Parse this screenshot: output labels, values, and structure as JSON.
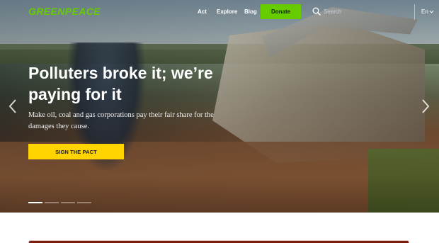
{
  "header": {
    "logo": "GREENPEACE",
    "nav": [
      {
        "label": "Act"
      },
      {
        "label": "Explore"
      },
      {
        "label": "Blog"
      }
    ],
    "donate_label": "Donate",
    "search": {
      "placeholder": "Search"
    },
    "language": "En"
  },
  "hero": {
    "headline": "Polluters broke it; we’re paying for it",
    "subtext": "Make oil, coal and gas corporations pay their fair share for the damages they cause.",
    "cta_label": "SIGN THE PACT",
    "slides": {
      "count": 4,
      "active": 1
    }
  },
  "colors": {
    "brand_green": "#66cc00",
    "cta_yellow": "#ffd400",
    "card_red": "#7a1e12"
  },
  "icons": [
    "search-icon",
    "chevron-down-icon",
    "chevron-left-icon",
    "chevron-right-icon"
  ]
}
